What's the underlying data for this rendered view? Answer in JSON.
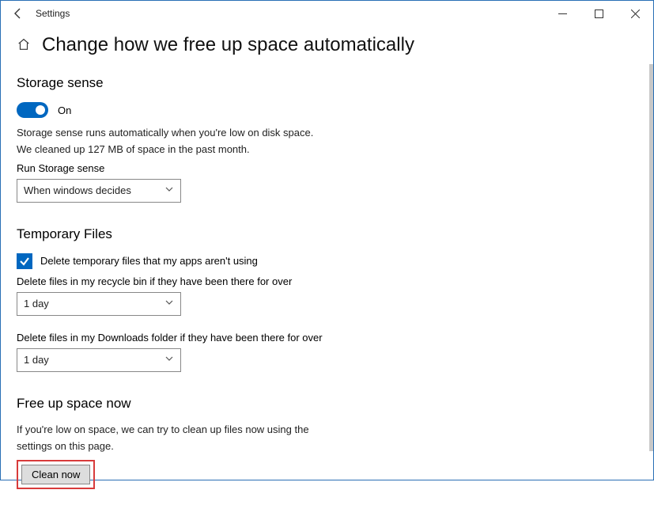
{
  "titlebar": {
    "app_title": "Settings"
  },
  "page": {
    "title": "Change how we free up space automatically"
  },
  "storage_sense": {
    "heading": "Storage sense",
    "toggle_state": "On",
    "desc_line1": "Storage sense runs automatically when you're low on disk space.",
    "desc_line2": "We cleaned up 127 MB of space in the past month.",
    "run_label": "Run Storage sense",
    "run_value": "When windows decides"
  },
  "temp_files": {
    "heading": "Temporary Files",
    "delete_temp_label": "Delete temporary files that my apps aren't using",
    "recycle_label": "Delete files in my recycle bin if they have been there for over",
    "recycle_value": "1 day",
    "downloads_label": "Delete files in my Downloads folder if they have been there for over",
    "downloads_value": "1 day"
  },
  "free_up": {
    "heading": "Free up space now",
    "desc_line1": "If you're low on space, we can try to clean up files now using the",
    "desc_line2": "settings on this page.",
    "button": "Clean now"
  }
}
